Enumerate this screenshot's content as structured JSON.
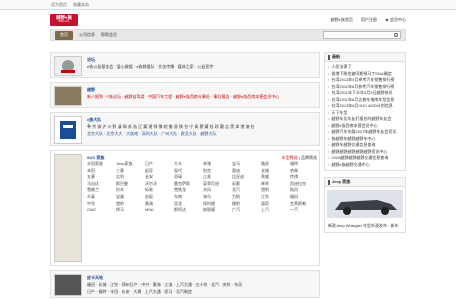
{
  "topbar": {
    "items": [
      "设为首页",
      "收藏本站"
    ]
  },
  "logo": {
    "main": "越野e族",
    "sub": "fblife.com"
  },
  "header": {
    "links": [
      "越野e族首页",
      "用户注册",
      "★ 会员中心"
    ]
  },
  "nav": {
    "home": "首页",
    "tabs": [
      "公司信息",
      "帮帮会员"
    ]
  },
  "cards": [
    {
      "title": "论坛",
      "lines": [
        "e族公益基金会 · 爱心救援 · e族救援队 · 文化传播 · 媒体之家 · 公益宣传"
      ]
    },
    {
      "title": "越野",
      "lines": [
        "新人报到 · F族论坛 · 越野自驾游 · 中国汽车工程 · 越野e族西南分事处 · 事后报告 · 越野e族西南本营会员中心"
      ]
    },
    {
      "title": "e族大队",
      "lines": [
        "粤 京 渝 沪 川 黔 滇 闽 苏 浙 辽 冀 湘 鄂 豫 皖 鲁 晋 陕 甘 宁 青 蒙 藏 桂 琼 疆 吉 黑 津 港 澳 台",
        "北京大队 · 北京大大 · 大族地 · 深圳大队 · 广州大队 · 欧亚大队 · 越野大队"
      ]
    },
    {
      "title": "SUV 家族",
      "tabs": [
        "车型筛选",
        "品牌筛选"
      ],
      "brands": [
        "丰田家族",
        "Jeep家族",
        "日产",
        "大众",
        "奔驰",
        "宝马",
        "路虎",
        "福特",
        "本田",
        "三菱",
        "起亚",
        "现代",
        "别克",
        "奥迪",
        "长城",
        "哈弗",
        "五菱",
        "吉利",
        "长安",
        "奇瑞",
        "江淮",
        "比亚迪",
        "荣威",
        "传祺",
        "马自达",
        "斯巴鲁",
        "沃尔沃",
        "雷克萨斯",
        "英菲尼迪",
        "讴歌",
        "林肯",
        "凯迪拉克",
        "雪佛兰",
        "铃木",
        "标致",
        "雪铁龙",
        "东风",
        "北汽",
        "猎豹",
        "陆风",
        "众泰",
        "宝骏",
        "启辰",
        "东南",
        "海马",
        "力帆",
        "江铃",
        "福田",
        "中华",
        "猎豹",
        "黄海",
        "双龙",
        "保时捷",
        "捷豹",
        "道奇",
        "克莱斯勒",
        "GMC",
        "悍马",
        "MINI",
        "斯柯达",
        "纳智捷",
        "广汽",
        "上汽",
        "一汽"
      ]
    },
    {
      "title": "皮卡天地",
      "lines": [
        "福田 · 长城 · 江铃 · 郑州日产 · 中兴 · 黄海 · 江淮 · 上汽大通 · 五十铃 · 北汽 · 庆铃 · 东风",
        "日产 · 福特 · 丰田 · 长安 · 大通 · 上汽大通 · 凯马 · 北汽制造"
      ]
    }
  ],
  "side": {
    "news_title": "最新",
    "news": [
      "人民法律了",
      "香港下跌也被阿斯顿马丁DNA确定",
      "台湾2013年5月参考汽车销售排行榜",
      "台湾2011年8月参考汽车销售排行榜",
      "台湾2011年下半年3月3日越野快讯",
      "台湾2011年8月吉普车指南车型信息",
      "台湾2013年8月IX10 4WD计划信息",
      "天下车型",
      "越野车及车友们报名的越野车友会",
      "越野e族西南本营会员中心",
      "越野汽车东路2027年越野车友会资讯",
      "各越野车越野越野车中心",
      "越野车越野交通信息查询",
      "越野越野越野越野越野资讯中心",
      "2020越野越野越野交通信息查询",
      "越野e族越野交通中心"
    ],
    "jeep_title": "Jeep 家族",
    "jeep_caption": "新款Jeep Wrangler 车型外观发布 · 新车"
  }
}
